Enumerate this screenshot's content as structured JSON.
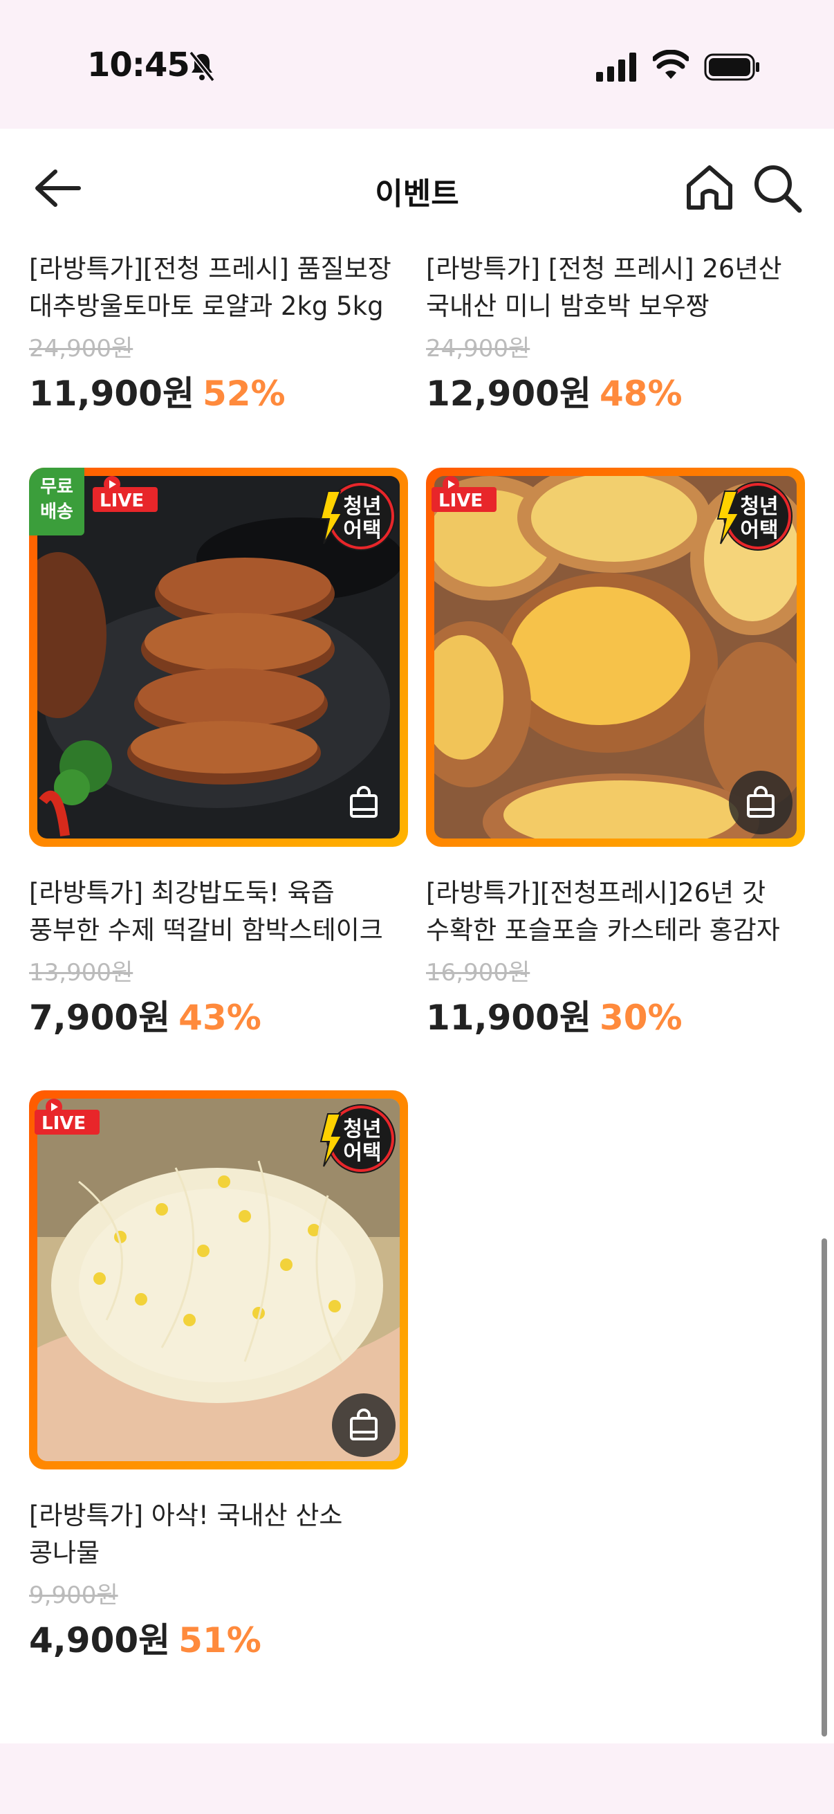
{
  "status": {
    "time": "10:45"
  },
  "header": {
    "title": "이벤트"
  },
  "top_products": [
    {
      "name": "[라방특가][전청 프레시] 품질보장 대추방울토마토 로얄과 2kg 5kg",
      "original_price": "24,900원",
      "price": "11,900원",
      "discount": "52%"
    },
    {
      "name": "[라방특가] [전청 프레시] 26년산 국내산 미니 밤호박 보우짱",
      "original_price": "24,900원",
      "price": "12,900원",
      "discount": "48%"
    }
  ],
  "products": [
    {
      "name": "[라방특가] 최강밥도둑! 육즙 풍부한 수제 떡갈비 함박스테이크",
      "original_price": "13,900원",
      "price": "7,900원",
      "discount": "43%",
      "free_shipping": "무료\n배송",
      "live": "LIVE",
      "youth_badge": "청년\n어택"
    },
    {
      "name": "[라방특가][전청프레시]26년 갓 수확한 포슬포슬 카스테라 홍감자",
      "original_price": "16,900원",
      "price": "11,900원",
      "discount": "30%",
      "live": "LIVE",
      "youth_badge": "청년\n어택"
    },
    {
      "name": "[라방특가] 아삭! 국내산 산소 콩나물",
      "original_price": "9,900원",
      "price": "4,900원",
      "discount": "51%",
      "live": "LIVE",
      "youth_badge": "청년\n어택"
    }
  ],
  "colors": {
    "accent": "#ff8a3c",
    "live_red": "#e8262a",
    "free_green": "#3b9e3b"
  }
}
